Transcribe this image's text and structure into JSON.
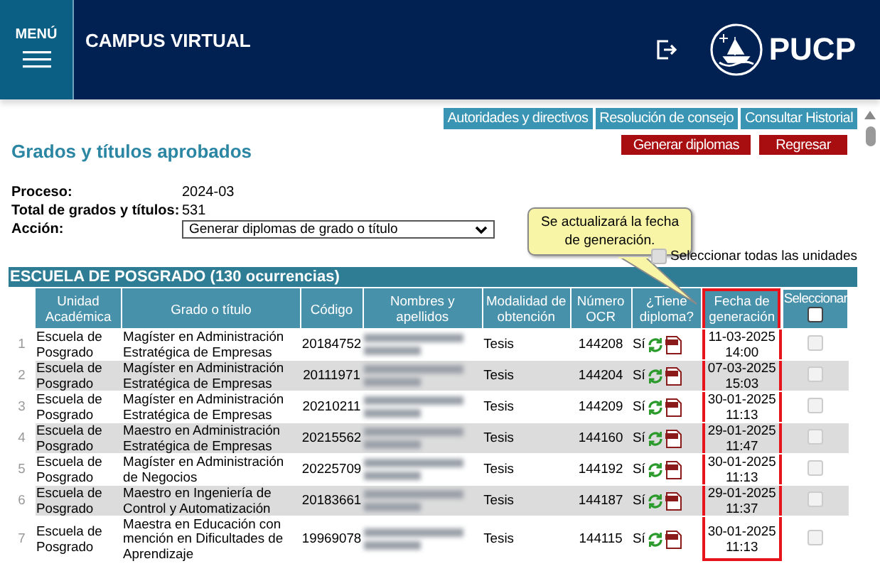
{
  "header": {
    "menu_label": "MENÚ",
    "title": "CAMPUS VIRTUAL",
    "logo_text": "PUCP"
  },
  "top_links": [
    "Autoridades y directivos",
    "Resolución de consejo",
    "Consultar Historial"
  ],
  "page_title": "Grados y títulos aprobados",
  "buttons": [
    "Generar diplomas",
    "Regresar"
  ],
  "info": [
    {
      "label": "Proceso:",
      "value": "2024-03"
    },
    {
      "label": "Total de grados y títulos:",
      "value": "531"
    }
  ],
  "action": {
    "label": "Acción:",
    "value": "Generar diplomas de grado o título"
  },
  "tooltip": {
    "text": "Se actualizará la fecha de generación."
  },
  "select_all": {
    "label": "Seleccionar todas las unidades",
    "checked": false
  },
  "section_title": "ESCUELA DE POSGRADO (130 ocurrencias)",
  "table": {
    "columns": [
      {
        "label": "Unidad Académica",
        "highlight": false
      },
      {
        "label": "Grado o título",
        "highlight": false
      },
      {
        "label": "Código",
        "highlight": false
      },
      {
        "label": "Nombres y apellidos",
        "highlight": false
      },
      {
        "label": "Modalidad de obtención",
        "highlight": false
      },
      {
        "label": "Número OCR",
        "highlight": false
      },
      {
        "label": "¿Tiene diploma?",
        "highlight": false
      },
      {
        "label": "Fecha de generación",
        "highlight": true
      },
      {
        "label": "Seleccionar",
        "highlight": false
      }
    ],
    "header_checked": false,
    "rows": [
      {
        "index": "1",
        "unidad": "Escuela de Posgrado",
        "grado": "Magíster en Administración Estratégica de Empresas",
        "codigo": "20184752",
        "modalidad": "Tesis",
        "ocr": "144208",
        "tiene": "Sí",
        "fecha": "11-03-2025 14:00",
        "selected": false,
        "disabled": true
      },
      {
        "index": "2",
        "unidad": "Escuela de Posgrado",
        "grado": "Magíster en Administración Estratégica de Empresas",
        "codigo": "20111971",
        "modalidad": "Tesis",
        "ocr": "144204",
        "tiene": "Sí",
        "fecha": "07-03-2025 15:03",
        "selected": false,
        "disabled": true
      },
      {
        "index": "3",
        "unidad": "Escuela de Posgrado",
        "grado": "Magíster en Administración Estratégica de Empresas",
        "codigo": "20210211",
        "modalidad": "Tesis",
        "ocr": "144209",
        "tiene": "Sí",
        "fecha": "30-01-2025 11:13",
        "selected": false,
        "disabled": true
      },
      {
        "index": "4",
        "unidad": "Escuela de Posgrado",
        "grado": "Maestro en Administración Estratégica de Empresas",
        "codigo": "20215562",
        "modalidad": "Tesis",
        "ocr": "144160",
        "tiene": "Sí",
        "fecha": "29-01-2025 11:47",
        "selected": false,
        "disabled": true
      },
      {
        "index": "5",
        "unidad": "Escuela de Posgrado",
        "grado": "Magíster en Administración de Negocios",
        "codigo": "20225709",
        "modalidad": "Tesis",
        "ocr": "144192",
        "tiene": "Sí",
        "fecha": "30-01-2025 11:13",
        "selected": false,
        "disabled": true
      },
      {
        "index": "6",
        "unidad": "Escuela de Posgrado",
        "grado": "Maestro en Ingeniería de Control y Automatización",
        "codigo": "20183661",
        "modalidad": "Tesis",
        "ocr": "144187",
        "tiene": "Sí",
        "fecha": "29-01-2025 11:37",
        "selected": false,
        "disabled": true
      },
      {
        "index": "7",
        "unidad": "Escuela de Posgrado",
        "grado": "Maestra en Educación con mención en Dificultades de Aprendizaje",
        "codigo": "19969078",
        "modalidad": "Tesis",
        "ocr": "144115",
        "tiene": "Sí",
        "fecha": "30-01-2025 11:13",
        "selected": false,
        "disabled": true
      }
    ]
  }
}
